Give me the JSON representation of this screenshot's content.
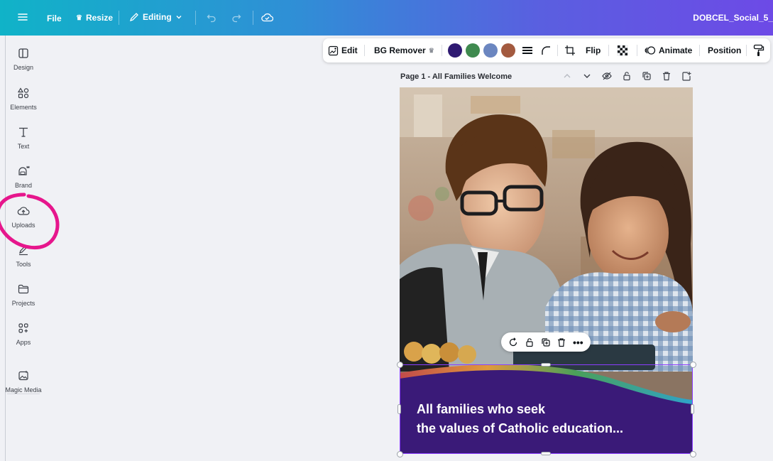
{
  "topbar": {
    "file_label": "File",
    "resize_label": "Resize",
    "editing_label": "Editing",
    "doc_title": "DOBCEL_Social_5_"
  },
  "sidebar": {
    "items": [
      {
        "label": "Design",
        "icon": "layout-icon"
      },
      {
        "label": "Elements",
        "icon": "shapes-icon"
      },
      {
        "label": "Text",
        "icon": "text-icon"
      },
      {
        "label": "Brand",
        "icon": "brand-icon"
      },
      {
        "label": "Uploads",
        "icon": "cloud-upload-icon"
      },
      {
        "label": "Tools",
        "icon": "pen-icon"
      },
      {
        "label": "Projects",
        "icon": "folder-icon"
      },
      {
        "label": "Apps",
        "icon": "apps-icon"
      },
      {
        "label": "Magic Media",
        "icon": "magic-media-icon"
      }
    ]
  },
  "toolbar": {
    "edit_label": "Edit",
    "bg_remover_label": "BG Remover",
    "flip_label": "Flip",
    "animate_label": "Animate",
    "position_label": "Position",
    "swatches": [
      "#2f1a72",
      "#3f8a4f",
      "#6b86c0",
      "#a35a3f"
    ]
  },
  "page": {
    "title": "Page 1 - All Families Welcome",
    "banner_line1": "All families who seek",
    "banner_line2": "the values of Catholic education...",
    "banner_color": "#3a1a78"
  },
  "annotation": {
    "color": "#e6168c"
  }
}
